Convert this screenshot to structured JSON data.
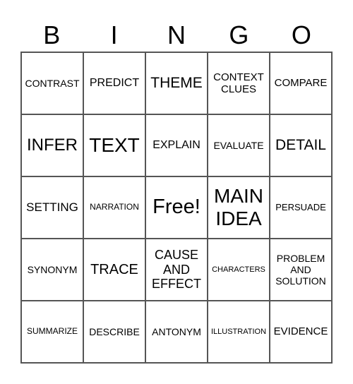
{
  "header": [
    "B",
    "I",
    "N",
    "G",
    "O"
  ],
  "cells": [
    {
      "text": "CONTRAST",
      "size": 14
    },
    {
      "text": "PREDICT",
      "size": 16
    },
    {
      "text": "THEME",
      "size": 21
    },
    {
      "text": "CONTEXT CLUES",
      "size": 15
    },
    {
      "text": "COMPARE",
      "size": 15
    },
    {
      "text": "INFER",
      "size": 24
    },
    {
      "text": "TEXT",
      "size": 28
    },
    {
      "text": "EXPLAIN",
      "size": 16
    },
    {
      "text": "EVALUATE",
      "size": 14
    },
    {
      "text": "DETAIL",
      "size": 21
    },
    {
      "text": "SETTING",
      "size": 17
    },
    {
      "text": "NARRATION",
      "size": 12
    },
    {
      "text": "Free!",
      "size": 29
    },
    {
      "text": "MAIN IDEA",
      "size": 28
    },
    {
      "text": "PERSUADE",
      "size": 13
    },
    {
      "text": "SYNONYM",
      "size": 14
    },
    {
      "text": "TRACE",
      "size": 20
    },
    {
      "text": "CAUSE AND EFFECT",
      "size": 18
    },
    {
      "text": "CHARACTERS",
      "size": 11
    },
    {
      "text": "PROBLEM AND SOLUTION",
      "size": 14
    },
    {
      "text": "SUMMARIZE",
      "size": 12
    },
    {
      "text": "DESCRIBE",
      "size": 14
    },
    {
      "text": "ANTONYM",
      "size": 14
    },
    {
      "text": "ILLUSTRATION",
      "size": 11
    },
    {
      "text": "EVIDENCE",
      "size": 15
    }
  ]
}
